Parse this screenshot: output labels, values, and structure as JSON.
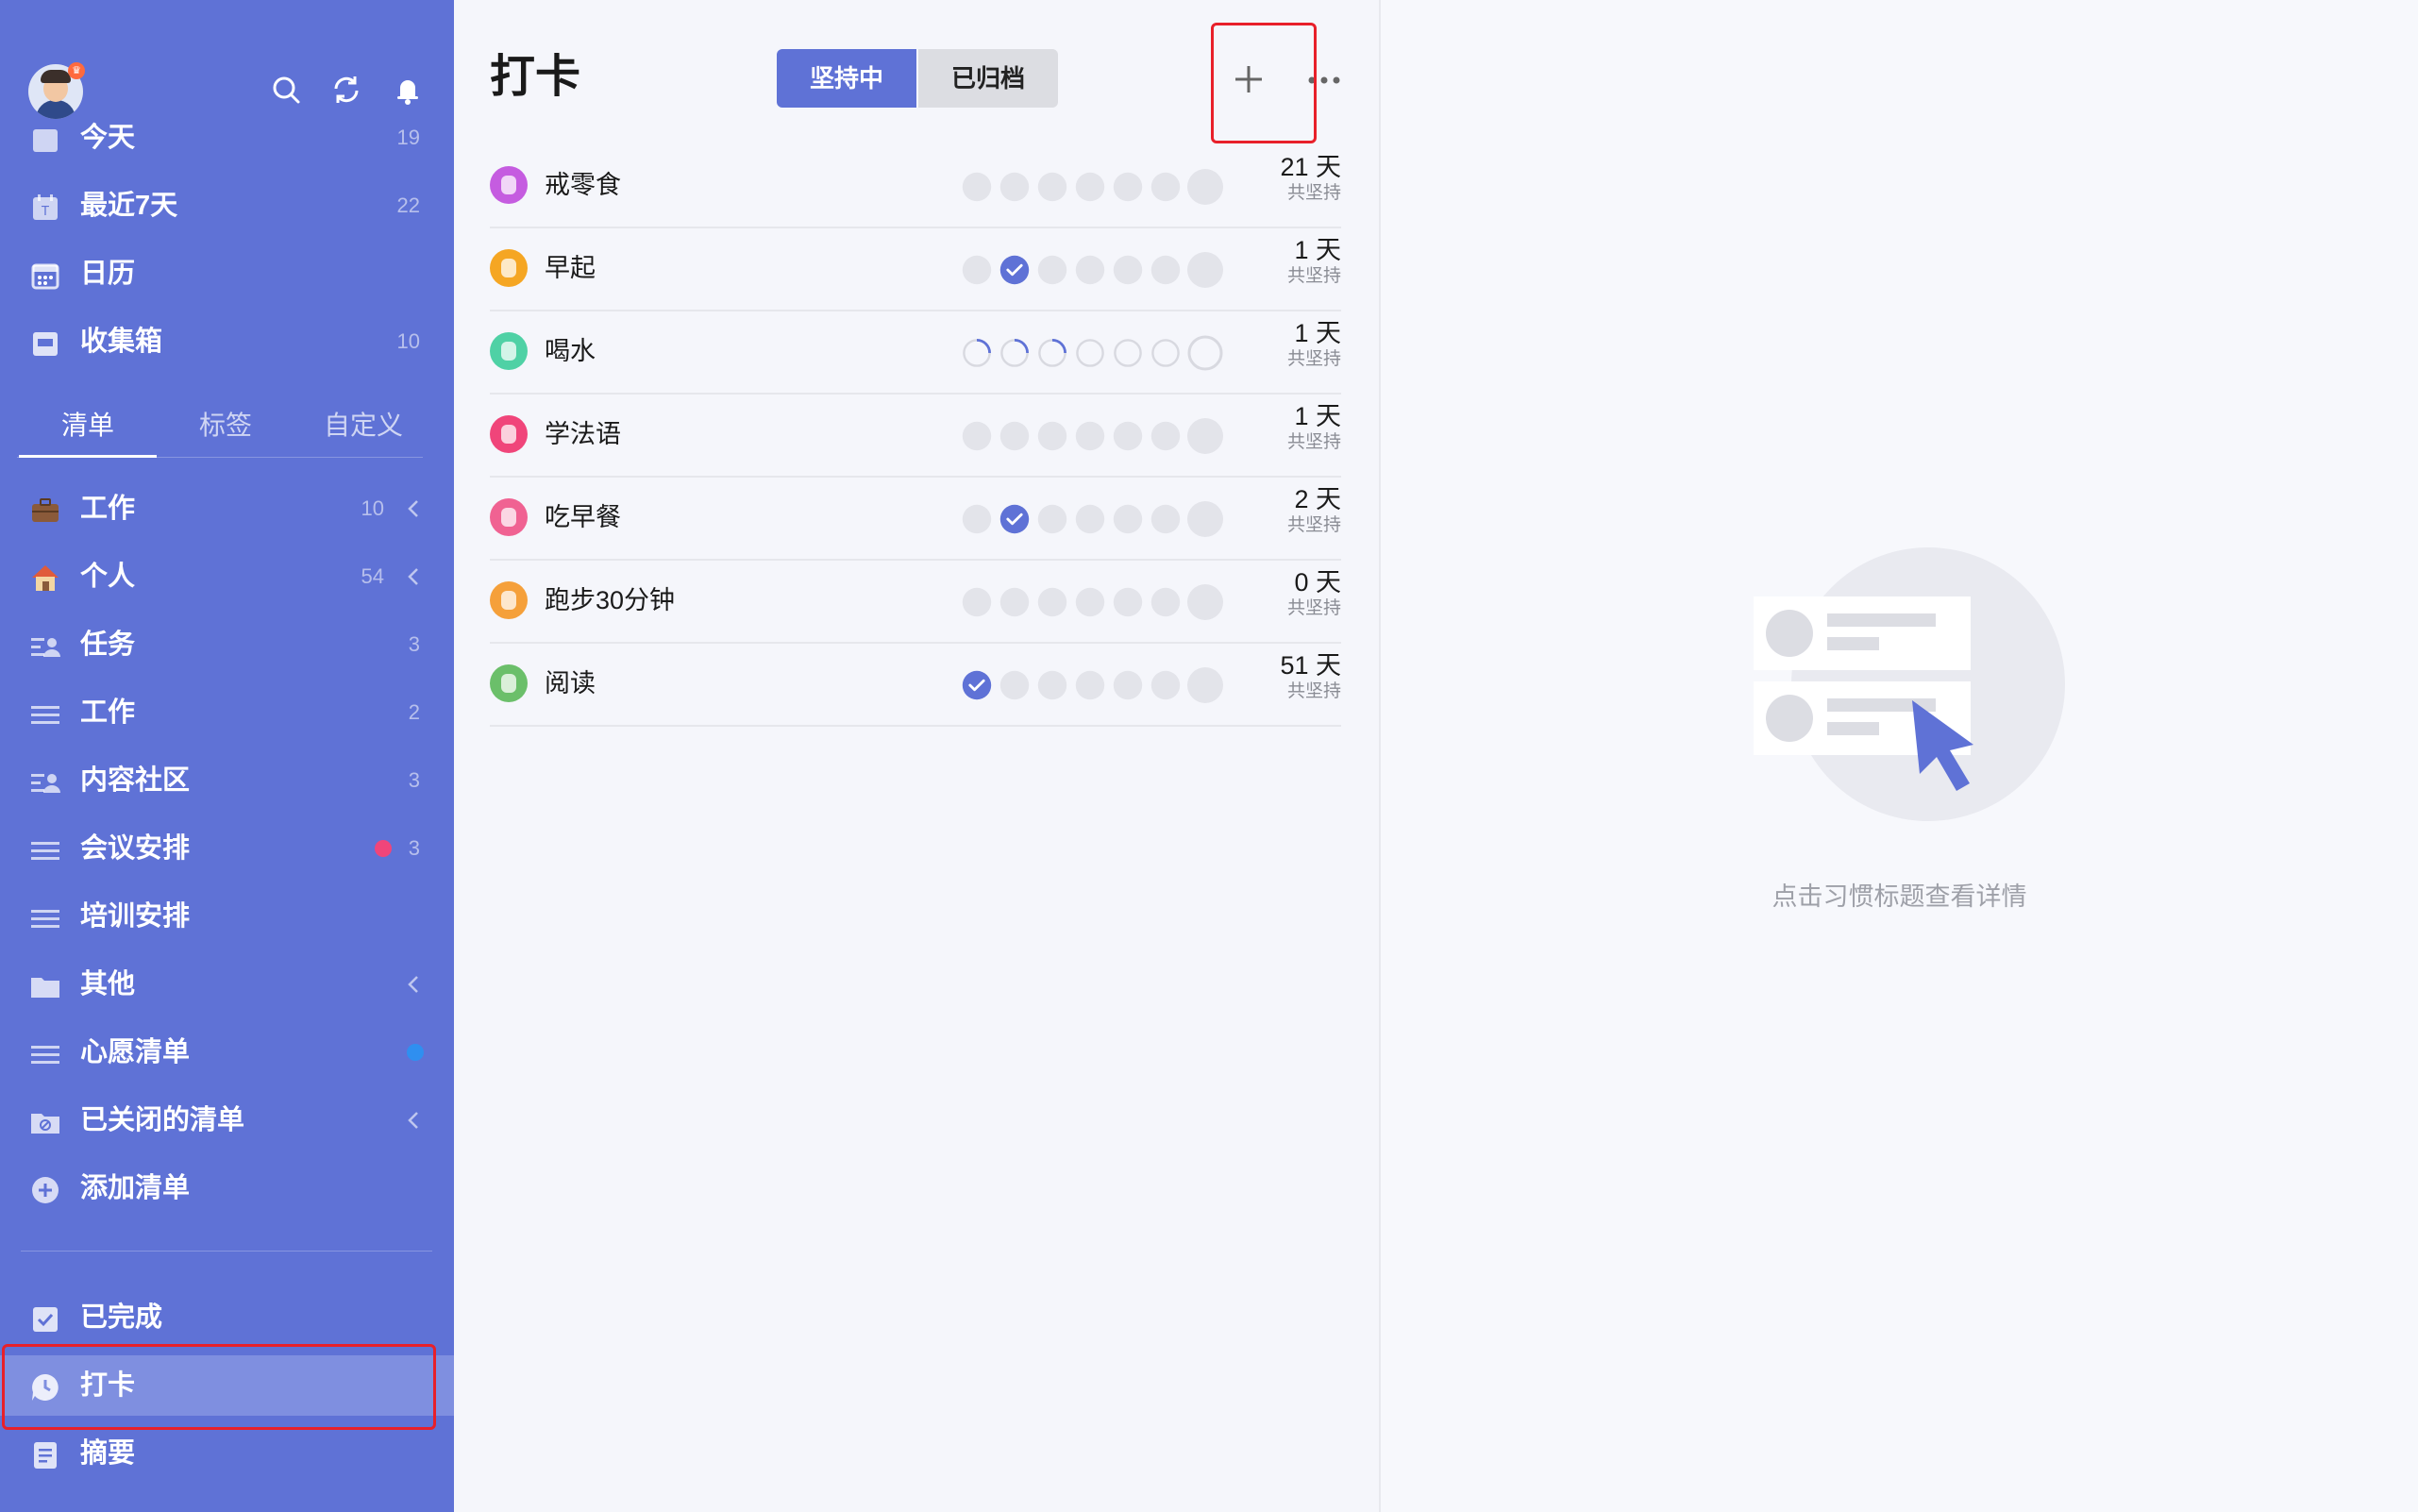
{
  "sidebar": {
    "top_items": [
      {
        "label": "今天",
        "count": "19"
      },
      {
        "label": "最近7天",
        "count": "22"
      },
      {
        "label": "日历",
        "count": ""
      },
      {
        "label": "收集箱",
        "count": "10"
      }
    ],
    "tabs": [
      "清单",
      "标签",
      "自定义"
    ],
    "lists": [
      {
        "label": "工作",
        "count": "10",
        "icon": "briefcase-icon",
        "expandable": true
      },
      {
        "label": "个人",
        "count": "54",
        "icon": "house-icon",
        "expandable": true
      },
      {
        "label": "任务",
        "count": "3",
        "icon": "shared-list-icon"
      },
      {
        "label": "工作",
        "count": "2",
        "icon": "list-icon"
      },
      {
        "label": "内容社区",
        "count": "3",
        "icon": "shared-list-icon"
      },
      {
        "label": "会议安排",
        "count": "3",
        "icon": "list-icon",
        "dot_color": "#f0457a"
      },
      {
        "label": "培训安排",
        "count": "",
        "icon": "list-icon"
      },
      {
        "label": "其他",
        "count": "",
        "icon": "folder-icon",
        "expandable": true
      },
      {
        "label": "心愿清单",
        "count": "",
        "icon": "list-icon",
        "dot_color": "#2f8ff0"
      },
      {
        "label": "已关闭的清单",
        "count": "",
        "icon": "closed-folder-icon",
        "expandable": true
      },
      {
        "label": "添加清单",
        "count": "",
        "icon": "plus-circle-icon"
      }
    ],
    "bottom_items": [
      {
        "label": "已完成"
      },
      {
        "label": "打卡"
      },
      {
        "label": "摘要"
      }
    ]
  },
  "main": {
    "title": "打卡",
    "segments": [
      "坚持中",
      "已归档"
    ],
    "habits": [
      {
        "name": "戒零食",
        "days": "21 天",
        "sub": "共坚持",
        "icon_color": "#c55ce0",
        "states": [
          "e",
          "e",
          "e",
          "e",
          "e",
          "e",
          "e"
        ]
      },
      {
        "name": "早起",
        "days": "1 天",
        "sub": "共坚持",
        "icon_color": "#f5a623",
        "states": [
          "e",
          "c",
          "e",
          "e",
          "e",
          "e",
          "e"
        ]
      },
      {
        "name": "喝水",
        "days": "1 天",
        "sub": "共坚持",
        "icon_color": "#4fd1a5",
        "states": [
          "p",
          "p",
          "p",
          "o",
          "o",
          "o",
          "o"
        ]
      },
      {
        "name": "学法语",
        "days": "1 天",
        "sub": "共坚持",
        "icon_color": "#f0457a",
        "states": [
          "e",
          "e",
          "e",
          "e",
          "e",
          "e",
          "e"
        ]
      },
      {
        "name": "吃早餐",
        "days": "2 天",
        "sub": "共坚持",
        "icon_color": "#f06292",
        "states": [
          "e",
          "c",
          "e",
          "e",
          "e",
          "e",
          "e"
        ]
      },
      {
        "name": "跑步30分钟",
        "days": "0 天",
        "sub": "共坚持",
        "icon_color": "#f5a03a",
        "states": [
          "e",
          "e",
          "e",
          "e",
          "e",
          "e",
          "e"
        ]
      },
      {
        "name": "阅读",
        "days": "51 天",
        "sub": "共坚持",
        "icon_color": "#6bbf6a",
        "states": [
          "c",
          "e",
          "e",
          "e",
          "e",
          "e",
          "e"
        ]
      }
    ]
  },
  "detail": {
    "hint": "点击习惯标题查看详情"
  },
  "colors": {
    "sidebar_bg": "#5f72d6",
    "accent": "#5f72d6",
    "highlight": "#e8202a"
  }
}
